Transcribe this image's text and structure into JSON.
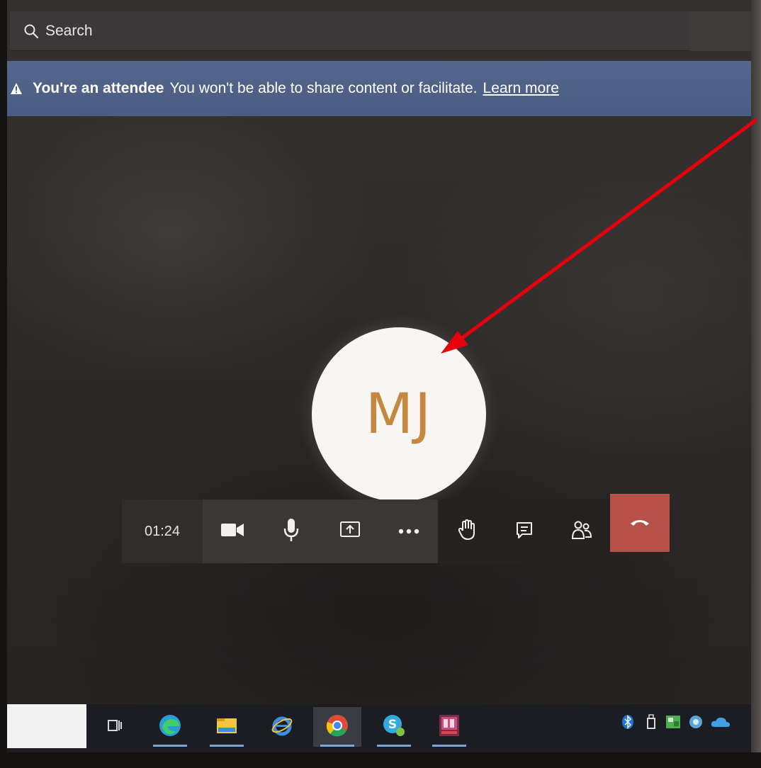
{
  "search": {
    "placeholder": "Search"
  },
  "banner": {
    "title": "You're an attendee",
    "message": "You won't be able to share content or facilitate.",
    "link": "Learn more"
  },
  "participant": {
    "initials": "MJ"
  },
  "call": {
    "timer": "01:24",
    "controls": [
      "camera-icon",
      "microphone-icon",
      "share-screen-icon",
      "more-icon",
      "raise-hand-icon",
      "chat-icon",
      "participants-icon",
      "hang-up-icon"
    ]
  },
  "taskbar": {
    "apps": [
      "task-view-icon",
      "edge-icon",
      "file-explorer-icon",
      "internet-explorer-icon",
      "chrome-icon",
      "skype-icon",
      "app-icon"
    ],
    "tray": [
      "bluetooth-icon",
      "usb-icon",
      "tray-app-icon",
      "tray-app-icon",
      "onedrive-icon"
    ]
  },
  "colors": {
    "banner": "#4d6086",
    "avatar_text": "#c6873f",
    "hangup": "#b7514a",
    "annotation_arrow": "#e8000b"
  }
}
